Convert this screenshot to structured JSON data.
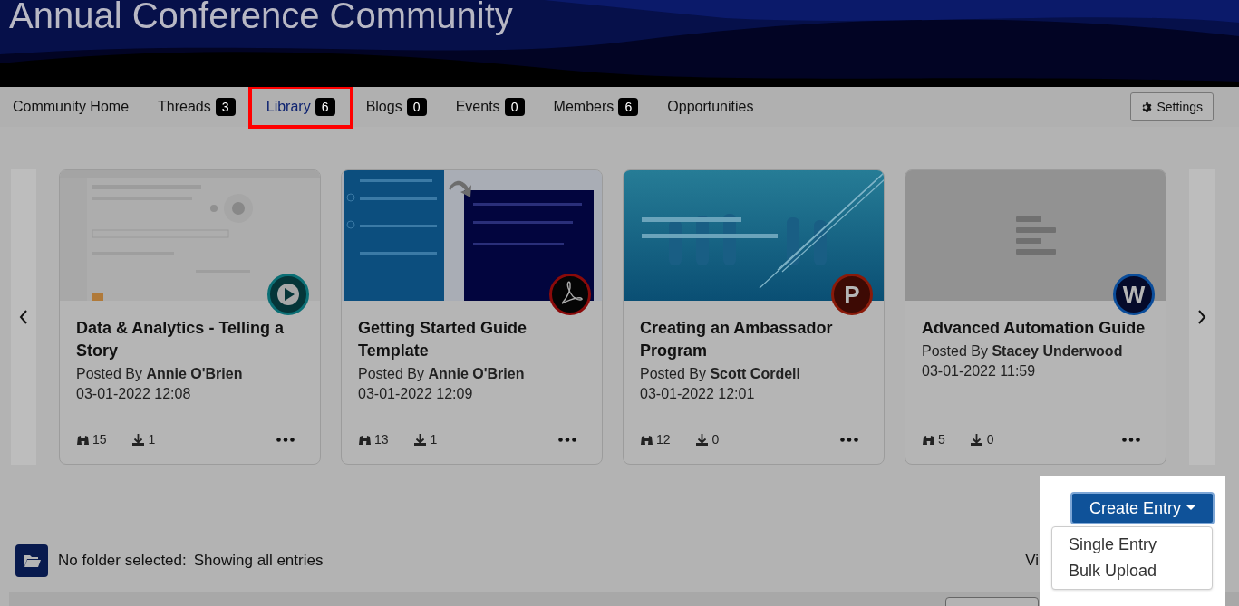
{
  "header": {
    "title": "Annual Conference Community"
  },
  "tabs": [
    {
      "label": "Community Home",
      "selected": false
    },
    {
      "label": "Threads",
      "count": "3",
      "selected": false
    },
    {
      "label": "Library",
      "count": "6",
      "selected": true
    },
    {
      "label": "Blogs",
      "count": "0",
      "selected": false
    },
    {
      "label": "Events",
      "count": "0",
      "selected": false
    },
    {
      "label": "Members",
      "count": "6",
      "selected": false
    },
    {
      "label": "Opportunities",
      "selected": false
    }
  ],
  "settings_button": "Settings",
  "cards": [
    {
      "file_badge": {
        "kind": "video"
      },
      "title": "Data & Analytics - Telling a Story",
      "posted_by_label": "Posted By",
      "author": "Annie O'Brien",
      "date": "03-01-2022 12:08",
      "views": "15",
      "downloads": "1"
    },
    {
      "file_badge": {
        "kind": "pdf"
      },
      "title": "Getting Started Guide Template",
      "posted_by_label": "Posted By",
      "author": "Annie O'Brien",
      "date": "03-01-2022 12:09",
      "views": "13",
      "downloads": "1"
    },
    {
      "file_badge": {
        "kind": "letter",
        "letter": "P",
        "color": "#3d0a04"
      },
      "title": "Creating an Ambassador Program",
      "posted_by_label": "Posted By",
      "author": "Scott Cordell",
      "date": "03-01-2022 12:01",
      "views": "12",
      "downloads": "0"
    },
    {
      "thumbnail": {
        "kind": "placeholder"
      },
      "file_badge": {
        "kind": "letter",
        "letter": "W",
        "color": "#050a2a"
      },
      "title": "Advanced Automation Guide",
      "posted_by_label": "Posted By",
      "author": "Stacey Underwood",
      "date": "03-01-2022 11:59",
      "views": "5",
      "downloads": "0"
    }
  ],
  "folder_status": {
    "label": "No folder selected:",
    "text": "Showing all entries"
  },
  "partial_link": "Vi",
  "create_entry": {
    "label": "Create Entry",
    "menu": [
      "Single Entry",
      "Bulk Upload"
    ]
  }
}
